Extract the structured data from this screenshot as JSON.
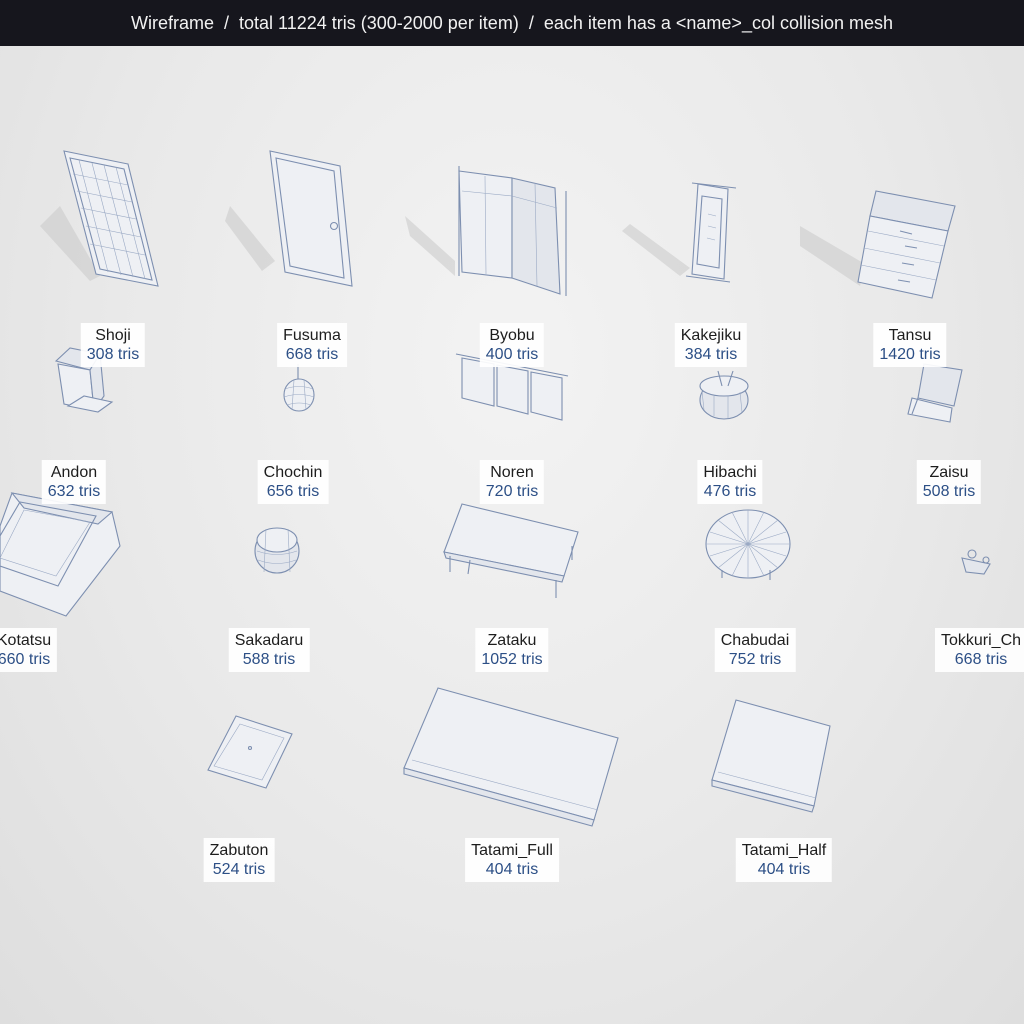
{
  "header": {
    "title": "Wireframe  /  total 11224 tris (300-2000 per item)  /  each item has a <name>_col collision mesh"
  },
  "colors": {
    "header_bg": "#16161d",
    "tris_text": "#2c4f86",
    "wire": "#7d8fb0"
  },
  "items": [
    {
      "id": "shoji",
      "name": "Shoji",
      "tris": "308 tris"
    },
    {
      "id": "fusuma",
      "name": "Fusuma",
      "tris": "668 tris"
    },
    {
      "id": "byobu",
      "name": "Byobu",
      "tris": "400 tris"
    },
    {
      "id": "kakejiku",
      "name": "Kakejiku",
      "tris": "384 tris"
    },
    {
      "id": "tansu",
      "name": "Tansu",
      "tris": "1420 tris"
    },
    {
      "id": "andon",
      "name": "Andon",
      "tris": "632 tris"
    },
    {
      "id": "chochin",
      "name": "Chochin",
      "tris": "656 tris"
    },
    {
      "id": "noren",
      "name": "Noren",
      "tris": "720 tris"
    },
    {
      "id": "hibachi",
      "name": "Hibachi",
      "tris": "476 tris"
    },
    {
      "id": "zaisu",
      "name": "Zaisu",
      "tris": "508 tris"
    },
    {
      "id": "kotatsu",
      "name": "Kotatsu",
      "tris": "660 tris"
    },
    {
      "id": "sakadaru",
      "name": "Sakadaru",
      "tris": "588 tris"
    },
    {
      "id": "zataku",
      "name": "Zataku",
      "tris": "1052 tris"
    },
    {
      "id": "chabudai",
      "name": "Chabudai",
      "tris": "752 tris"
    },
    {
      "id": "tokkuri",
      "name": "Tokkuri_Ch",
      "tris": "668 tris"
    },
    {
      "id": "zabuton",
      "name": "Zabuton",
      "tris": "524 tris"
    },
    {
      "id": "tatami_full",
      "name": "Tatami_Full",
      "tris": "404 tris"
    },
    {
      "id": "tatami_half",
      "name": "Tatami_Half",
      "tris": "404 tris"
    }
  ]
}
